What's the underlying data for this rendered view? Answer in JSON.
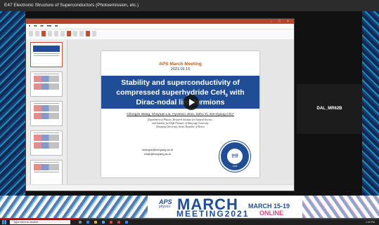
{
  "session_title": "E47 Electronic Structure of Superconductors (Photoemission, etc.)",
  "slide": {
    "meeting": "APS March Meeting",
    "date": "2021.03.16",
    "title_lines": [
      "Stability and superconductivity of",
      "compressed superhydride CeH",
      "Dirac-nodal line fermions"
    ],
    "title_subscript": "9",
    "title_suffix": " with",
    "authors": "Chongze Wang, Shuyuan Liu, Hyunsoo Jeon, Seho Yi, Jun-Hyung Cho*",
    "affiliation_1": "Department of Physics, Research Institute for Natural Science,",
    "affiliation_2": "and Institute for High Pressure at Hanyang University",
    "affiliation_3": "Hanyang University, Seoul, Republic of Korea",
    "email_1": "chongze@hanyang.ac.kr",
    "email_2": "chojh@hanyang.ac.kr",
    "seal_text": "한양",
    "seal_year": "1939"
  },
  "participant_name": "DAL_MR62B",
  "banner": {
    "aps_label": "APS",
    "aps_sub": "physics",
    "march": "MARCH",
    "meeting_year": "MEETING2021",
    "dates": "MARCH 15-19",
    "online": "ONLINE"
  },
  "taskbar": {
    "search_placeholder": "Type here to search",
    "clock": "1:40 PM"
  },
  "progress": 0.21,
  "thumb_count": 5
}
